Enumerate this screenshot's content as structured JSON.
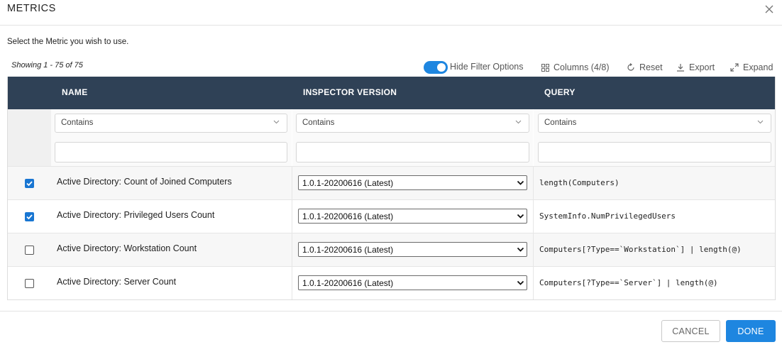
{
  "dialog": {
    "title": "METRICS",
    "instructions": "Select the Metric you wish to use."
  },
  "toolbar": {
    "showing": "Showing 1 - 75 of 75",
    "hide_filter_label": "Hide Filter Options",
    "hide_filter_on": true,
    "columns_label": "Columns (4/8)",
    "reset_label": "Reset",
    "export_label": "Export",
    "expand_label": "Expand"
  },
  "table": {
    "columns": [
      "NAME",
      "INSPECTOR VERSION",
      "QUERY"
    ],
    "filters": [
      {
        "mode": "Contains",
        "value": ""
      },
      {
        "mode": "Contains",
        "value": ""
      },
      {
        "mode": "Contains",
        "value": ""
      }
    ],
    "rows": [
      {
        "checked": true,
        "name": "Active Directory: Count of Joined Computers",
        "version": "1.0.1-20200616 (Latest)",
        "query": "length(Computers)"
      },
      {
        "checked": true,
        "name": "Active Directory: Privileged Users Count",
        "version": "1.0.1-20200616 (Latest)",
        "query": "SystemInfo.NumPrivilegedUsers"
      },
      {
        "checked": false,
        "name": "Active Directory: Workstation Count",
        "version": "1.0.1-20200616 (Latest)",
        "query": "Computers[?Type==`Workstation`] | length(@)"
      },
      {
        "checked": false,
        "name": "Active Directory: Server Count",
        "version": "1.0.1-20200616 (Latest)",
        "query": "Computers[?Type==`Server`] | length(@)"
      }
    ]
  },
  "footer": {
    "cancel_label": "CANCEL",
    "done_label": "DONE"
  },
  "colors": {
    "header_bg": "#2f4156",
    "accent": "#1e86e0",
    "checkbox": "#1976d2"
  }
}
